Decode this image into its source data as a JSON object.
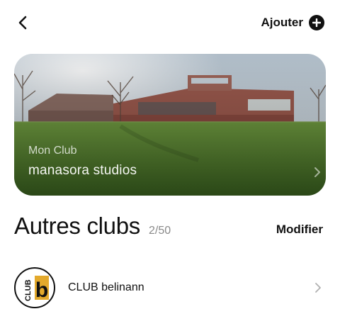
{
  "header": {
    "back_icon": "chevron-left-icon",
    "add_label": "Ajouter",
    "add_icon": "plus-circle-icon"
  },
  "my_club": {
    "caption": "Mon Club",
    "name": "manasora studios",
    "chevron_icon": "chevron-right-icon"
  },
  "other_clubs": {
    "title": "Autres clubs",
    "count": "2/50",
    "edit_label": "Modifier",
    "items": [
      {
        "name": "CLUB belinann",
        "logo_text": "CLUB",
        "logo_letter": "b",
        "logo_accent": "#E3A92C",
        "chevron_icon": "chevron-right-icon"
      }
    ]
  }
}
